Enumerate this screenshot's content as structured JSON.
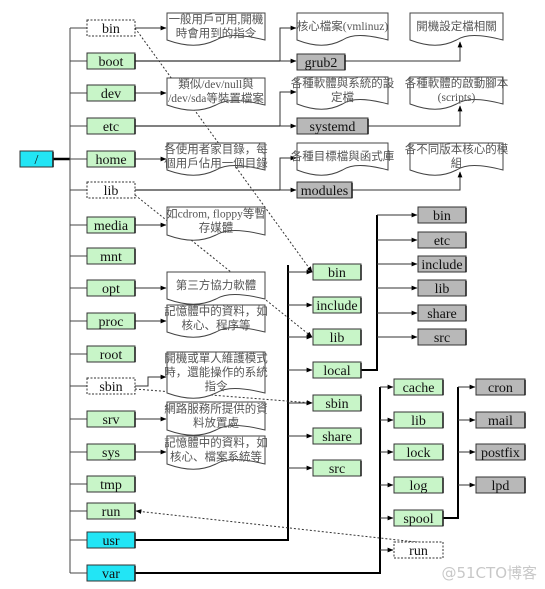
{
  "colors": {
    "root": "#22e5f5",
    "dir": "#c8f5c8",
    "link": "#ffffff",
    "gray": "#b8b8b8",
    "note": "#ffffff"
  },
  "root": {
    "label": "/"
  },
  "level1": [
    {
      "label": "bin",
      "style": "link"
    },
    {
      "label": "boot",
      "style": "dir"
    },
    {
      "label": "dev",
      "style": "dir"
    },
    {
      "label": "etc",
      "style": "dir"
    },
    {
      "label": "home",
      "style": "dir"
    },
    {
      "label": "lib",
      "style": "link"
    },
    {
      "label": "media",
      "style": "dir"
    },
    {
      "label": "mnt",
      "style": "dir"
    },
    {
      "label": "opt",
      "style": "dir"
    },
    {
      "label": "proc",
      "style": "dir"
    },
    {
      "label": "root",
      "style": "dir"
    },
    {
      "label": "sbin",
      "style": "link"
    },
    {
      "label": "srv",
      "style": "dir"
    },
    {
      "label": "sys",
      "style": "dir"
    },
    {
      "label": "tmp",
      "style": "dir"
    },
    {
      "label": "run",
      "style": "dir"
    },
    {
      "label": "usr",
      "style": "root"
    },
    {
      "label": "var",
      "style": "root"
    }
  ],
  "notes": [
    {
      "for": "bin",
      "lines": [
        "一般用戶可用,開機",
        "時會用到的指令"
      ]
    },
    {
      "for": "dev",
      "lines": [
        "類似/dev/null與",
        "/dev/sda等裝置檔案"
      ]
    },
    {
      "for": "home",
      "lines": [
        "各使用者家目錄，每",
        "個用戶佔用一個目錄"
      ]
    },
    {
      "for": "media",
      "lines": [
        "如cdrom, floppy等暫",
        "存媒體"
      ]
    },
    {
      "for": "opt",
      "lines": [
        "第三方協力軟體"
      ]
    },
    {
      "for": "proc",
      "lines": [
        "記憶體中的資料，如",
        "核心、程序等"
      ]
    },
    {
      "for": "sbin",
      "lines": [
        "開機或單人維護模式",
        "時，還能操作的系統",
        "指令"
      ]
    },
    {
      "for": "srv",
      "lines": [
        "網路服務所提供的資",
        "料放置處"
      ]
    },
    {
      "for": "sys",
      "lines": [
        "記憶體中的資料，如",
        "核心、檔案系統等"
      ]
    }
  ],
  "boot_branch": {
    "child": "grub2",
    "note_left": [
      "核心檔案(vmlinuz)"
    ],
    "note_right": [
      "開機設定檔相關"
    ]
  },
  "etc_branch": {
    "child": "systemd",
    "note_left": [
      "各種軟體與系統的設",
      "定檔"
    ],
    "note_right": [
      "各種軟體的啟動腳本",
      "(scripts)"
    ]
  },
  "lib_branch": {
    "child": "modules",
    "note_left": [
      "各種目標檔與函式庫"
    ],
    "note_right": [
      "各不同版本核心的模",
      "組"
    ]
  },
  "usr_children": [
    "bin",
    "include",
    "lib",
    "local",
    "sbin",
    "share",
    "src"
  ],
  "local_children": [
    "bin",
    "etc",
    "include",
    "lib",
    "share",
    "src"
  ],
  "var_children": [
    "cache",
    "lib",
    "lock",
    "log",
    "spool",
    "run"
  ],
  "spool_children": [
    "cron",
    "mail",
    "postfix",
    "lpd"
  ],
  "links": [
    {
      "from": "/bin",
      "to": "/usr/bin"
    },
    {
      "from": "/lib",
      "to": "/usr/lib"
    },
    {
      "from": "/sbin",
      "to": "/usr/sbin"
    },
    {
      "from": "/var/run",
      "to": "/run"
    }
  ],
  "watermark": "@51CTO博客"
}
